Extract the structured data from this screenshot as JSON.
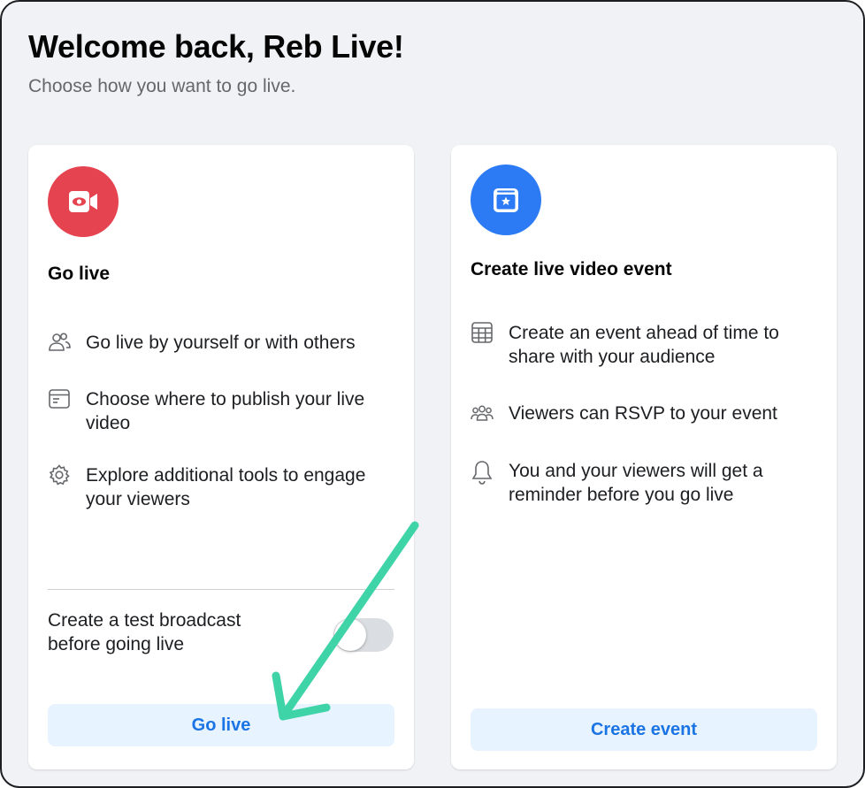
{
  "header": {
    "title": "Welcome back, Reb Live!",
    "subtitle": "Choose how you want to go live."
  },
  "go_live_card": {
    "icon": "video-camera-icon",
    "icon_color": "#e4434f",
    "title": "Go live",
    "features": [
      {
        "icon": "people-icon",
        "text": "Go live by yourself or with others"
      },
      {
        "icon": "browser-window-icon",
        "text": "Choose where to publish your live video"
      },
      {
        "icon": "gear-icon",
        "text": "Explore additional tools to engage your viewers"
      }
    ],
    "test_broadcast": {
      "label": "Create a test broadcast before going live",
      "enabled": false
    },
    "button_label": "Go live"
  },
  "event_card": {
    "icon": "calendar-star-icon",
    "icon_color": "#2d7bf4",
    "title": "Create live video event",
    "features": [
      {
        "icon": "calendar-grid-icon",
        "text": "Create an event ahead of time to share with your audience"
      },
      {
        "icon": "group-icon",
        "text": "Viewers can RSVP to your event"
      },
      {
        "icon": "bell-icon",
        "text": "You and your viewers will get a reminder before you go live"
      }
    ],
    "button_label": "Create event"
  },
  "annotation": {
    "type": "arrow",
    "color": "#3fd3a8",
    "points_to": "go-live-button"
  }
}
